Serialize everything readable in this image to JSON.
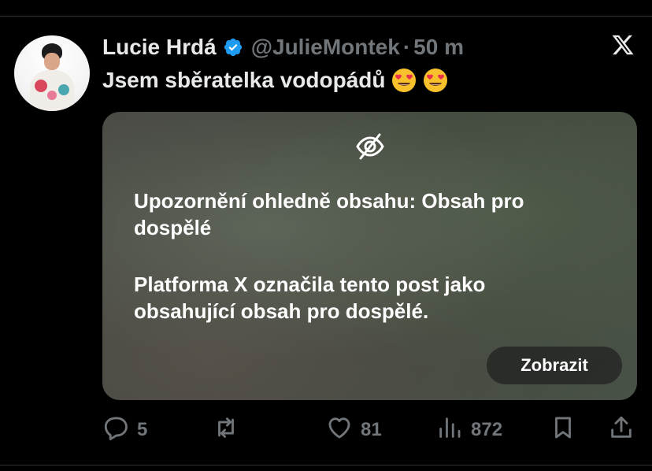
{
  "tweet": {
    "display_name": "Lucie Hrdá",
    "handle": "@JulieMontek",
    "separator": "·",
    "time": "50 m",
    "text": "Jsem sběratelka vodopádů"
  },
  "media_warning": {
    "title": "Upozornění ohledně obsahu: Obsah pro dospělé",
    "body": "Platforma X označila tento post jako obsahující obsah pro dospělé.",
    "show_label": "Zobrazit"
  },
  "actions": {
    "reply_count": "5",
    "retweet_count": "",
    "like_count": "81",
    "views_count": "872"
  },
  "icons": {
    "verified": "verified-badge-icon",
    "x_logo": "x-logo-icon",
    "emoji": "heart-eyes-emoji-icon",
    "eye_slash": "eye-slash-icon",
    "reply": "reply-icon",
    "retweet": "retweet-icon",
    "like": "heart-icon",
    "views": "views-bar-chart-icon",
    "bookmark": "bookmark-icon",
    "share": "share-icon"
  },
  "colors": {
    "background": "#000000",
    "text_primary": "#e7e9ea",
    "text_secondary": "#71767b",
    "verified_blue": "#1d9bf0",
    "divider": "#2f3336"
  }
}
